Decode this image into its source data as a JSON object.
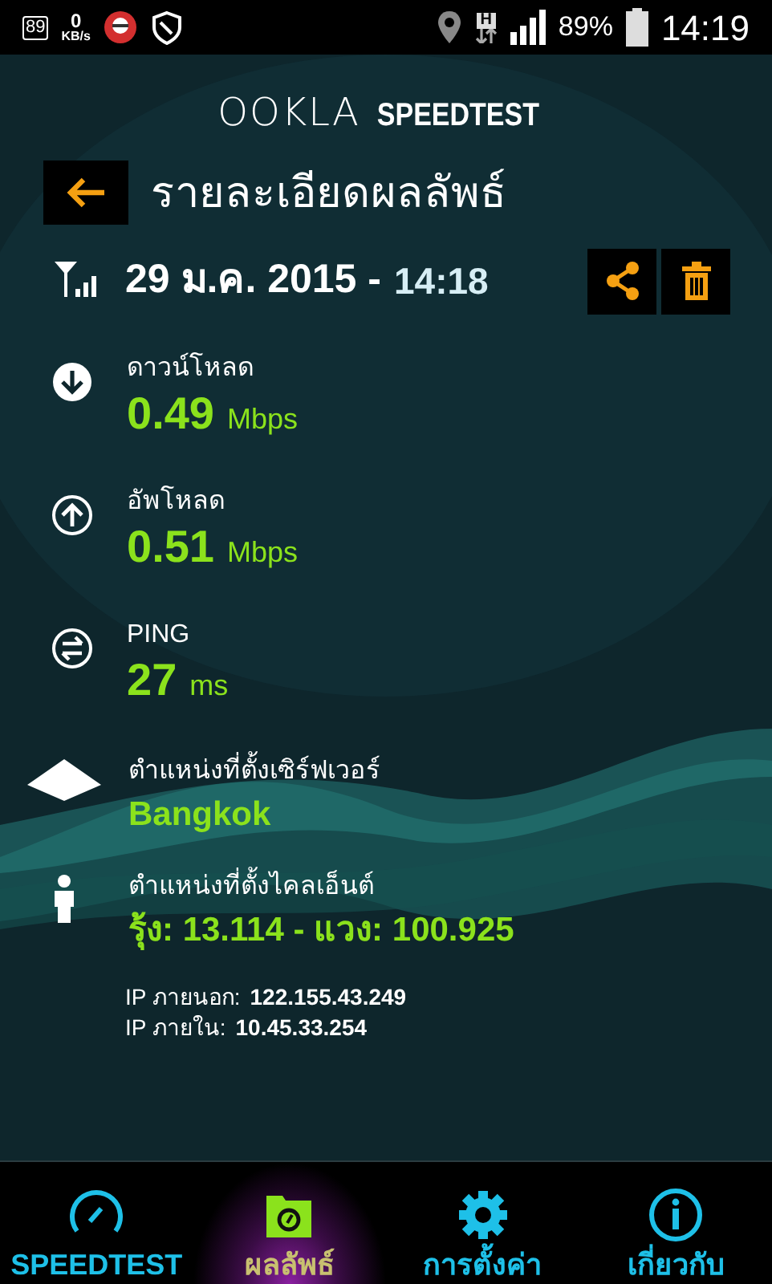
{
  "status_bar": {
    "battery_badge": "89",
    "speed_value": "0",
    "speed_unit": "KB/s",
    "network": "H",
    "battery": "89%",
    "time": "14:19"
  },
  "header": {
    "logo_left": "OOKLA",
    "logo_right": "SPEEDTEST"
  },
  "title": "รายละเอียดผลลัพธ์",
  "result": {
    "date": "29 ม.ค. 2015 -",
    "time": "14:18"
  },
  "metrics": [
    {
      "kind": "download",
      "label": "ดาวน์โหลด",
      "value": "0.49",
      "unit": "Mbps"
    },
    {
      "kind": "upload",
      "label": "อัพโหลด",
      "value": "0.51",
      "unit": "Mbps"
    },
    {
      "kind": "ping",
      "label": "PING",
      "value": "27",
      "unit": "ms"
    }
  ],
  "locations": [
    {
      "kind": "server",
      "label": "ตำแหน่งที่ตั้งเซิร์ฟเวอร์",
      "value": "Bangkok"
    },
    {
      "kind": "client",
      "label": "ตำแหน่งที่ตั้งไคลเอ็นต์",
      "value": "รุ้ง: 13.114 - แวง: 100.925"
    }
  ],
  "ips": [
    {
      "label": "IP ภายนอก:",
      "value": "122.155.43.249"
    },
    {
      "label": "IP ภายใน:",
      "value": "10.45.33.254"
    }
  ],
  "tabs": [
    {
      "kind": "speedtest",
      "label": "SPEEDTEST",
      "selected": false
    },
    {
      "kind": "results",
      "label": "ผลลัพธ์",
      "selected": true
    },
    {
      "kind": "settings",
      "label": "การตั้งค่า",
      "selected": false
    },
    {
      "kind": "about",
      "label": "เกี่ยวกับ",
      "selected": false
    }
  ]
}
